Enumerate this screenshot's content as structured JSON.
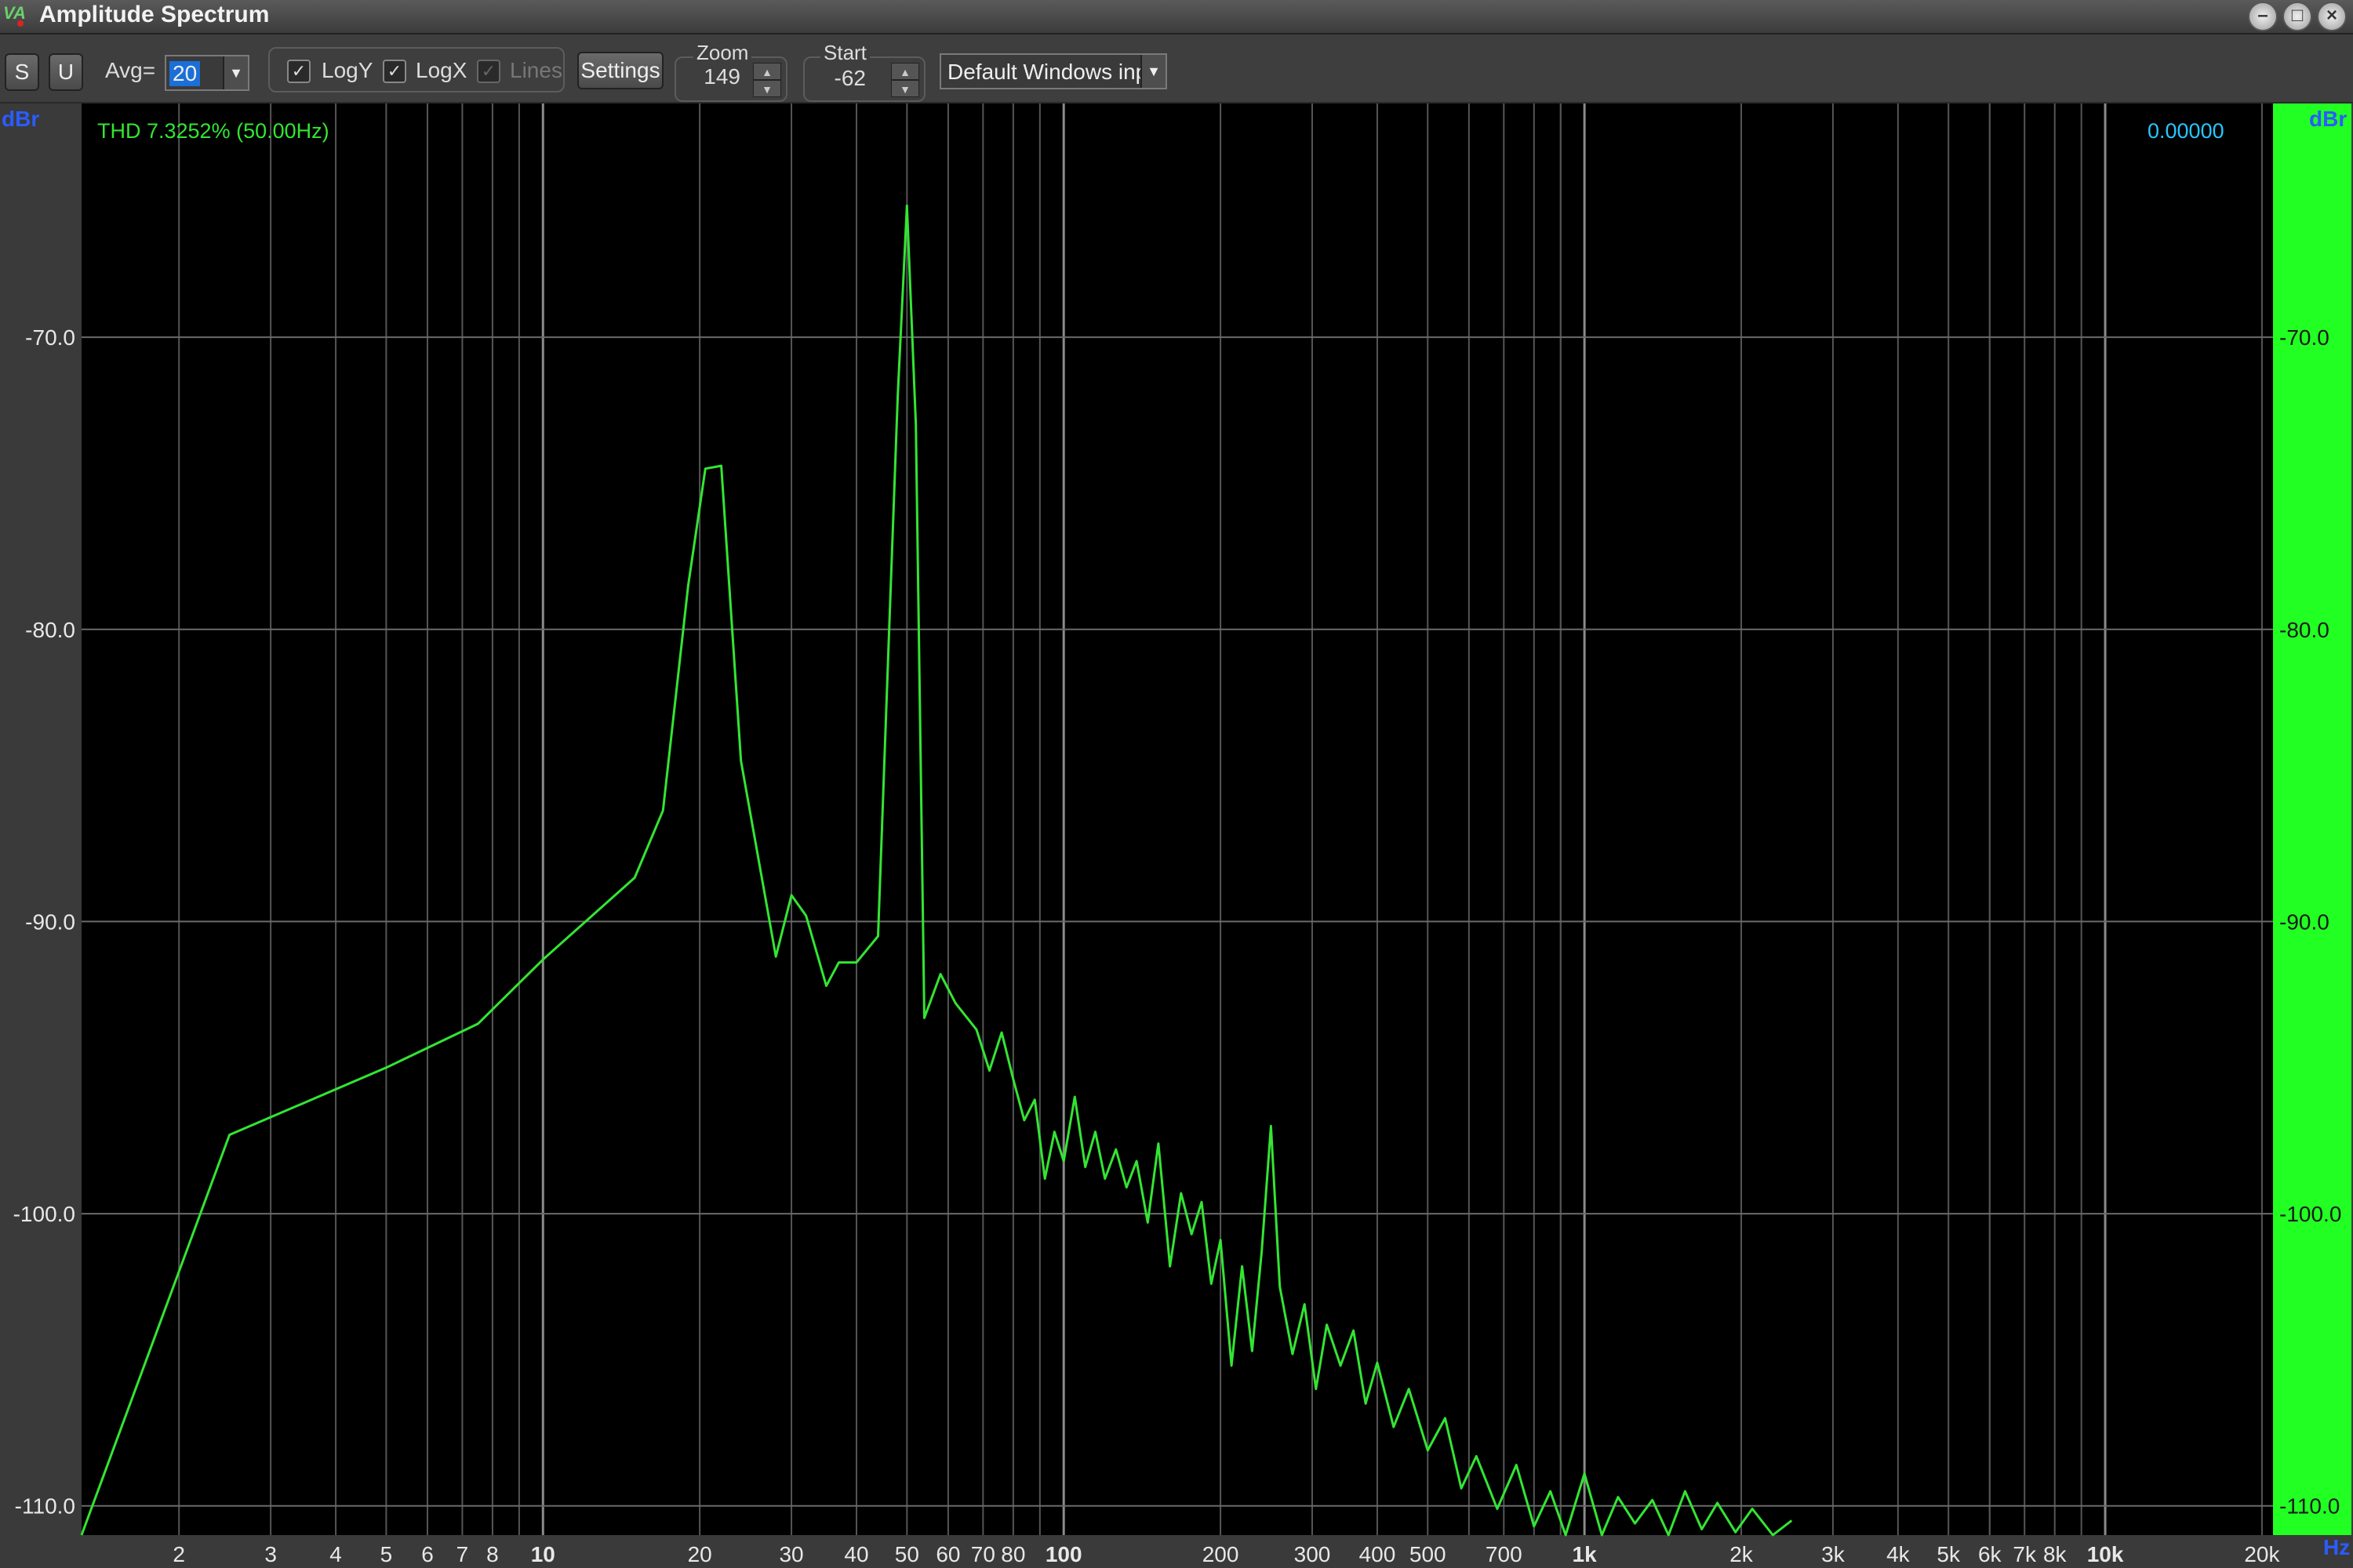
{
  "window": {
    "title": "Amplitude Spectrum"
  },
  "toolbar": {
    "s_label": "S",
    "u_label": "U",
    "avg_label": "Avg=",
    "avg_value": "20",
    "logy_label": "LogY",
    "logx_label": "LogX",
    "lines_label": "Lines",
    "settings_label": "Settings",
    "zoom_caption": "Zoom",
    "zoom_value": "149",
    "start_caption": "Start",
    "start_value": "-62",
    "window_select": "Default Windows inp"
  },
  "plot": {
    "y_unit_left": "dBr",
    "y_unit_right": "dBr",
    "x_unit": "Hz",
    "thd_readout": "THD 7.3252% (50.00Hz)",
    "cursor_readout": "0.00000",
    "colors": {
      "background": "#000000",
      "trace": "#33e533",
      "grid": "#555555",
      "meter": "#22ff22",
      "readout_thd": "#33e533",
      "readout_cursor": "#26c6ff"
    }
  },
  "chart_data": {
    "type": "line",
    "x_scale": "log",
    "xlim": [
      1.3,
      21000
    ],
    "ylim": [
      -111,
      -62
    ],
    "grid": true,
    "y_ticks": [
      {
        "value": -70,
        "label": "-70.0"
      },
      {
        "value": -80,
        "label": "-80.0"
      },
      {
        "value": -90,
        "label": "-90.0"
      },
      {
        "value": -100,
        "label": "-100.0"
      },
      {
        "value": -110,
        "label": "-110.0"
      }
    ],
    "x_ticks": [
      {
        "value": 2,
        "label": "2",
        "major": false
      },
      {
        "value": 3,
        "label": "3",
        "major": false
      },
      {
        "value": 4,
        "label": "4",
        "major": false
      },
      {
        "value": 5,
        "label": "5",
        "major": false
      },
      {
        "value": 6,
        "label": "6",
        "major": false
      },
      {
        "value": 7,
        "label": "7",
        "major": false
      },
      {
        "value": 8,
        "label": "8",
        "major": false
      },
      {
        "value": 10,
        "label": "10",
        "major": true
      },
      {
        "value": 20,
        "label": "20",
        "major": false
      },
      {
        "value": 30,
        "label": "30",
        "major": false
      },
      {
        "value": 40,
        "label": "40",
        "major": false
      },
      {
        "value": 50,
        "label": "50",
        "major": false
      },
      {
        "value": 60,
        "label": "60",
        "major": false
      },
      {
        "value": 70,
        "label": "70",
        "major": false
      },
      {
        "value": 80,
        "label": "80",
        "major": false
      },
      {
        "value": 100,
        "label": "100",
        "major": true
      },
      {
        "value": 200,
        "label": "200",
        "major": false
      },
      {
        "value": 300,
        "label": "300",
        "major": false
      },
      {
        "value": 400,
        "label": "400",
        "major": false
      },
      {
        "value": 500,
        "label": "500",
        "major": false
      },
      {
        "value": 700,
        "label": "700",
        "major": false
      },
      {
        "value": 1000,
        "label": "1k",
        "major": true
      },
      {
        "value": 2000,
        "label": "2k",
        "major": false
      },
      {
        "value": 3000,
        "label": "3k",
        "major": false
      },
      {
        "value": 4000,
        "label": "4k",
        "major": false
      },
      {
        "value": 5000,
        "label": "5k",
        "major": false
      },
      {
        "value": 6000,
        "label": "6k",
        "major": false
      },
      {
        "value": 7000,
        "label": "7k",
        "major": false
      },
      {
        "value": 8000,
        "label": "8k",
        "major": false
      },
      {
        "value": 10000,
        "label": "10k",
        "major": true
      },
      {
        "value": 20000,
        "label": "20k",
        "major": false
      }
    ],
    "series": [
      {
        "x": [
          1.3,
          2.5,
          5.0,
          7.5,
          10,
          15,
          17,
          19,
          20.5,
          22,
          24,
          28,
          30,
          32,
          35,
          37,
          40,
          44,
          46,
          48,
          50,
          52,
          54,
          58,
          62,
          68,
          72,
          76,
          80,
          84,
          88,
          92,
          96,
          100,
          105,
          110,
          115,
          120,
          126,
          132,
          138,
          145,
          152,
          160,
          168,
          176,
          184,
          192,
          200,
          210,
          220,
          230,
          240,
          250,
          260,
          275,
          290,
          305,
          320,
          340,
          360,
          380,
          400,
          430,
          460,
          500,
          540,
          580,
          620,
          680,
          740,
          800,
          860,
          920,
          1000,
          1080,
          1160,
          1250,
          1350,
          1450,
          1560,
          1680,
          1800,
          1950,
          2100,
          2300,
          2500
        ],
        "y": [
          -111,
          -97.3,
          -95,
          -93.5,
          -91.3,
          -88.5,
          -86.2,
          -78.5,
          -74.5,
          -74.4,
          -84.5,
          -91.2,
          -89.1,
          -89.8,
          -92.2,
          -91.4,
          -91.4,
          -90.5,
          -81,
          -72,
          -65.5,
          -73,
          -93.3,
          -91.8,
          -92.8,
          -93.7,
          -95.1,
          -93.8,
          -95.4,
          -96.8,
          -96.1,
          -98.8,
          -97.2,
          -98.2,
          -96.0,
          -98.4,
          -97.2,
          -98.8,
          -97.8,
          -99.1,
          -98.2,
          -100.3,
          -97.6,
          -101.8,
          -99.3,
          -100.7,
          -99.6,
          -102.4,
          -100.9,
          -105.2,
          -101.8,
          -104.7,
          -101.3,
          -97.0,
          -102.5,
          -104.8,
          -103.1,
          -106.0,
          -103.8,
          -105.2,
          -104.0,
          -106.5,
          -105.1,
          -107.3,
          -106.0,
          -108.1,
          -107.0,
          -109.4,
          -108.3,
          -110.1,
          -108.6,
          -110.7,
          -109.5,
          -111.0,
          -108.9,
          -111.0,
          -109.7,
          -110.6,
          -109.8,
          -111.0,
          -109.5,
          -110.8,
          -109.9,
          -110.9,
          -110.1,
          -111.0,
          -110.5
        ]
      }
    ]
  }
}
